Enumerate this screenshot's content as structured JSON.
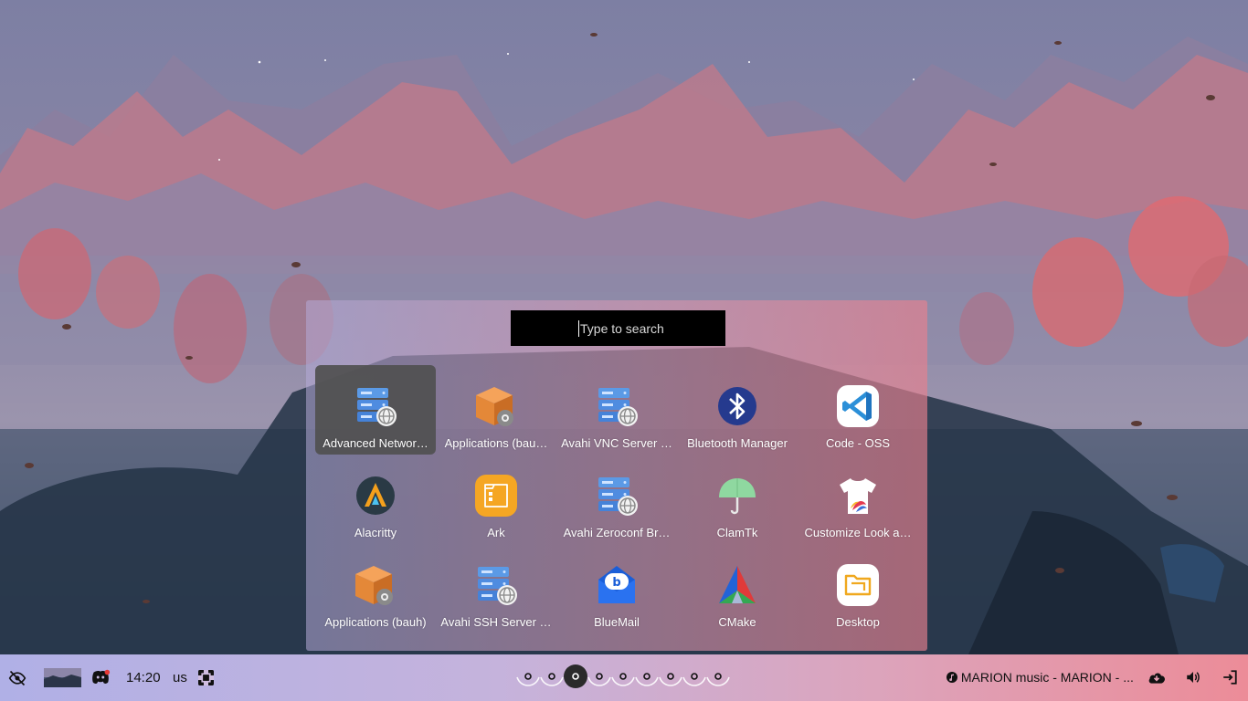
{
  "search": {
    "placeholder": "Type to search"
  },
  "apps": [
    {
      "label": "Advanced Networ…",
      "icon": "network-server-icon",
      "selected": true
    },
    {
      "label": "Applications (bau…",
      "icon": "package-box-icon"
    },
    {
      "label": "Avahi VNC Server …",
      "icon": "network-server-icon"
    },
    {
      "label": "Bluetooth Manager",
      "icon": "bluetooth-icon"
    },
    {
      "label": "Code - OSS",
      "icon": "vscode-icon"
    },
    {
      "label": "Alacritty",
      "icon": "alacritty-icon"
    },
    {
      "label": "Ark",
      "icon": "archive-icon"
    },
    {
      "label": "Avahi Zeroconf Br…",
      "icon": "network-server-icon"
    },
    {
      "label": "ClamTk",
      "icon": "umbrella-icon"
    },
    {
      "label": "Customize Look a…",
      "icon": "tshirt-icon"
    },
    {
      "label": "Applications (bauh)",
      "icon": "package-box-icon"
    },
    {
      "label": "Avahi SSH Server …",
      "icon": "network-server-icon"
    },
    {
      "label": "BlueMail",
      "icon": "bluemail-icon"
    },
    {
      "label": "CMake",
      "icon": "cmake-icon"
    },
    {
      "label": "Desktop",
      "icon": "folder-icon"
    }
  ],
  "taskbar": {
    "clock": "14:20",
    "keyboard_layout": "us",
    "media": "MARION music - MARION - ...",
    "workspace_count": 9,
    "active_workspace": 3
  },
  "colors": {
    "launcher_left": "#b4aad7",
    "launcher_right": "#e8808e",
    "selected_tile": "#505050",
    "taskbar_left": "#b0b0e6",
    "taskbar_right": "#ec8c98"
  }
}
